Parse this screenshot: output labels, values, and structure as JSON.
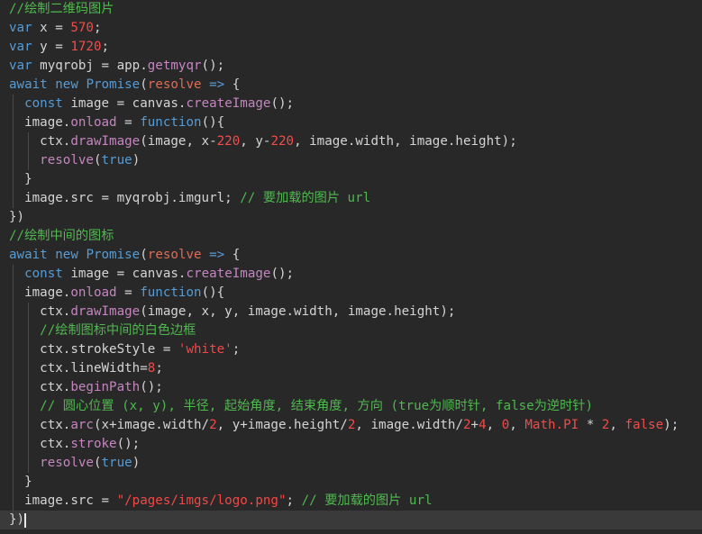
{
  "colors": {
    "background": "#282828",
    "current_line": "#3a3a3a",
    "comment": "#4fb84f",
    "keyword": "#569cd6",
    "number": "#f14c4c",
    "function": "#c586c0",
    "param": "#e06c55",
    "string": "#f44747",
    "plain": "#d4d4d4"
  },
  "editor": {
    "current_line": 27,
    "lines": [
      {
        "indent": 0,
        "tokens": [
          [
            "comment",
            "//绘制二维码图片"
          ]
        ]
      },
      {
        "indent": 0,
        "tokens": [
          [
            "keyword",
            "var"
          ],
          [
            "plain",
            " x = "
          ],
          [
            "number",
            "570"
          ],
          [
            "plain",
            ";"
          ]
        ]
      },
      {
        "indent": 0,
        "tokens": [
          [
            "keyword",
            "var"
          ],
          [
            "plain",
            " y = "
          ],
          [
            "number",
            "1720"
          ],
          [
            "plain",
            ";"
          ]
        ]
      },
      {
        "indent": 0,
        "tokens": [
          [
            "keyword",
            "var"
          ],
          [
            "plain",
            " myqrobj = app."
          ],
          [
            "function",
            "getmyqr"
          ],
          [
            "plain",
            "();"
          ]
        ]
      },
      {
        "indent": 0,
        "tokens": [
          [
            "keyword",
            "await"
          ],
          [
            "plain",
            " "
          ],
          [
            "keyword",
            "new"
          ],
          [
            "plain",
            " "
          ],
          [
            "keyword",
            "Promise"
          ],
          [
            "plain",
            "("
          ],
          [
            "param",
            "resolve"
          ],
          [
            "plain",
            " "
          ],
          [
            "keyword",
            "=>"
          ],
          [
            "plain",
            " {"
          ]
        ]
      },
      {
        "indent": 1,
        "tokens": [
          [
            "keyword",
            "const"
          ],
          [
            "plain",
            " image = canvas."
          ],
          [
            "function",
            "createImage"
          ],
          [
            "plain",
            "();"
          ]
        ]
      },
      {
        "indent": 1,
        "tokens": [
          [
            "plain",
            "image."
          ],
          [
            "function",
            "onload"
          ],
          [
            "plain",
            " = "
          ],
          [
            "keyword",
            "function"
          ],
          [
            "plain",
            "(){"
          ]
        ]
      },
      {
        "indent": 2,
        "tokens": [
          [
            "plain",
            "ctx."
          ],
          [
            "function",
            "drawImage"
          ],
          [
            "plain",
            "(image, x-"
          ],
          [
            "number",
            "220"
          ],
          [
            "plain",
            ", y-"
          ],
          [
            "number",
            "220"
          ],
          [
            "plain",
            ", image.width, image.height);"
          ]
        ]
      },
      {
        "indent": 2,
        "tokens": [
          [
            "function",
            "resolve"
          ],
          [
            "plain",
            "("
          ],
          [
            "keyword",
            "true"
          ],
          [
            "plain",
            ")"
          ]
        ]
      },
      {
        "indent": 1,
        "tokens": [
          [
            "plain",
            "}"
          ]
        ]
      },
      {
        "indent": 1,
        "tokens": [
          [
            "plain",
            "image.src = myqrobj.imgurl; "
          ],
          [
            "comment",
            "// 要加载的图片 url"
          ]
        ]
      },
      {
        "indent": 0,
        "tokens": [
          [
            "plain",
            "})"
          ]
        ]
      },
      {
        "indent": 0,
        "tokens": [
          [
            "comment",
            "//绘制中间的图标"
          ]
        ]
      },
      {
        "indent": 0,
        "tokens": [
          [
            "keyword",
            "await"
          ],
          [
            "plain",
            " "
          ],
          [
            "keyword",
            "new"
          ],
          [
            "plain",
            " "
          ],
          [
            "keyword",
            "Promise"
          ],
          [
            "plain",
            "("
          ],
          [
            "param",
            "resolve"
          ],
          [
            "plain",
            " "
          ],
          [
            "keyword",
            "=>"
          ],
          [
            "plain",
            " {"
          ]
        ]
      },
      {
        "indent": 1,
        "tokens": [
          [
            "keyword",
            "const"
          ],
          [
            "plain",
            " image = canvas."
          ],
          [
            "function",
            "createImage"
          ],
          [
            "plain",
            "();"
          ]
        ]
      },
      {
        "indent": 1,
        "tokens": [
          [
            "plain",
            "image."
          ],
          [
            "function",
            "onload"
          ],
          [
            "plain",
            " = "
          ],
          [
            "keyword",
            "function"
          ],
          [
            "plain",
            "(){"
          ]
        ]
      },
      {
        "indent": 2,
        "tokens": [
          [
            "plain",
            "ctx."
          ],
          [
            "function",
            "drawImage"
          ],
          [
            "plain",
            "(image, x, y, image.width, image.height);"
          ]
        ]
      },
      {
        "indent": 2,
        "tokens": [
          [
            "comment",
            "//绘制图标中间的白色边框"
          ]
        ]
      },
      {
        "indent": 2,
        "tokens": [
          [
            "plain",
            "ctx.strokeStyle = "
          ],
          [
            "string",
            "'white'"
          ],
          [
            "plain",
            ";"
          ]
        ]
      },
      {
        "indent": 2,
        "tokens": [
          [
            "plain",
            "ctx.lineWidth="
          ],
          [
            "number",
            "8"
          ],
          [
            "plain",
            ";"
          ]
        ]
      },
      {
        "indent": 2,
        "tokens": [
          [
            "plain",
            "ctx."
          ],
          [
            "function",
            "beginPath"
          ],
          [
            "plain",
            "();"
          ]
        ]
      },
      {
        "indent": 2,
        "tokens": [
          [
            "comment",
            "// 圆心位置 (x, y), 半径, 起始角度, 结束角度, 方向 (true为顺时针, false为逆时针)"
          ]
        ]
      },
      {
        "indent": 2,
        "tokens": [
          [
            "plain",
            "ctx."
          ],
          [
            "function",
            "arc"
          ],
          [
            "plain",
            "(x+image.width/"
          ],
          [
            "number",
            "2"
          ],
          [
            "plain",
            ", y+image.height/"
          ],
          [
            "number",
            "2"
          ],
          [
            "plain",
            ", image.width/"
          ],
          [
            "number",
            "2"
          ],
          [
            "plain",
            "+"
          ],
          [
            "number",
            "4"
          ],
          [
            "plain",
            ", "
          ],
          [
            "number",
            "0"
          ],
          [
            "plain",
            ", "
          ],
          [
            "number",
            "Math.PI"
          ],
          [
            "plain",
            " * "
          ],
          [
            "number",
            "2"
          ],
          [
            "plain",
            ", "
          ],
          [
            "number",
            "false"
          ],
          [
            "plain",
            ");"
          ]
        ]
      },
      {
        "indent": 2,
        "tokens": [
          [
            "plain",
            "ctx."
          ],
          [
            "function",
            "stroke"
          ],
          [
            "plain",
            "();"
          ]
        ]
      },
      {
        "indent": 2,
        "tokens": [
          [
            "function",
            "resolve"
          ],
          [
            "plain",
            "("
          ],
          [
            "keyword",
            "true"
          ],
          [
            "plain",
            ")"
          ]
        ]
      },
      {
        "indent": 1,
        "tokens": [
          [
            "plain",
            "}"
          ]
        ]
      },
      {
        "indent": 1,
        "tokens": [
          [
            "plain",
            "image.src = "
          ],
          [
            "string",
            "\"/pages/imgs/logo.png\""
          ],
          [
            "plain",
            "; "
          ],
          [
            "comment",
            "// 要加载的图片 url"
          ]
        ]
      },
      {
        "indent": 0,
        "tokens": [
          [
            "plain",
            "})"
          ]
        ]
      }
    ]
  }
}
